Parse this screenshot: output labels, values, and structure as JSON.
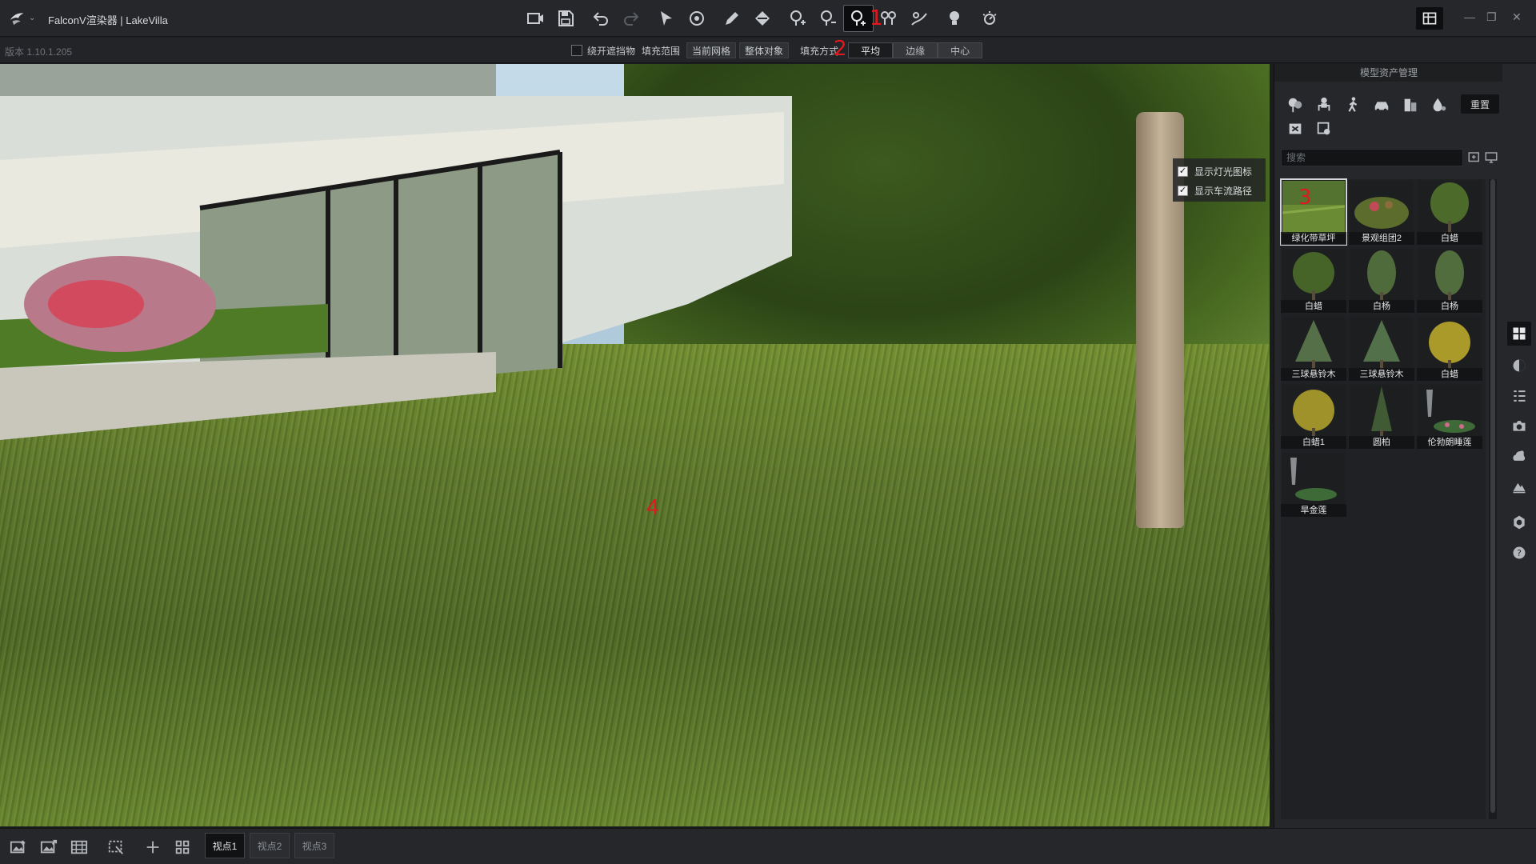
{
  "window": {
    "title": "FalconV渲染器 | LakeVilla",
    "version": "版本 1.10.1.205"
  },
  "toolbar": {
    "buttons": [
      {
        "icon": "camera-capture-icon"
      },
      {
        "icon": "save-icon"
      },
      {
        "icon": "undo-icon"
      },
      {
        "icon": "redo-icon"
      },
      {
        "icon": "select-arrow-icon"
      },
      {
        "icon": "rotate-view-icon"
      },
      {
        "icon": "pen-icon"
      },
      {
        "icon": "fill-bucket-icon"
      },
      {
        "icon": "plant-tree-icon"
      },
      {
        "icon": "plant-remove-icon"
      },
      {
        "icon": "plant-fill-icon"
      },
      {
        "icon": "plant-brush-icon"
      },
      {
        "icon": "plant-path-icon"
      },
      {
        "icon": "light-bulb-icon"
      },
      {
        "icon": "time-of-day-icon"
      }
    ],
    "active_index": 10,
    "marker_1": "1"
  },
  "fillbar": {
    "avoid_label": "绕开遮挡物",
    "range_label": "填充范围",
    "current_grid": "当前网格",
    "whole_object": "整体对象",
    "fill_mode_label": "填充方式",
    "marker_2": "2",
    "modes": [
      "平均",
      "边缘",
      "中心"
    ],
    "selected_mode": "平均"
  },
  "viewport": {
    "marker_4": "4",
    "overlay": {
      "show_light_icons": "显示灯光图标",
      "show_traffic_path": "显示车流路径"
    }
  },
  "panel": {
    "title": "模型资产管理",
    "reset_label": "重置",
    "search_placeholder": "搜索",
    "marker_3": "3",
    "categories": [
      "plants-category-icon",
      "people-sitting-icon",
      "people-walking-icon",
      "vehicle-icon",
      "building-icon",
      "water-drop-icon",
      "light-box-icon",
      "furniture-icon"
    ],
    "assets": [
      {
        "label": "绿化带草坪",
        "color": "#5c7a2e",
        "selected": true
      },
      {
        "label": "景观组团2",
        "color": "#6a7a36"
      },
      {
        "label": "白蜡",
        "color": "#4e6a2a"
      },
      {
        "label": "白蜡",
        "color": "#4a6428"
      },
      {
        "label": "白杨",
        "color": "#4d6a3a"
      },
      {
        "label": "白杨",
        "color": "#506c3c"
      },
      {
        "label": "三球悬铃木",
        "color": "#557048"
      },
      {
        "label": "三球悬铃木",
        "color": "#52704a"
      },
      {
        "label": "白蜡",
        "color": "#a99a2a"
      },
      {
        "label": "白蜡1",
        "color": "#9f922a"
      },
      {
        "label": "圆柏",
        "color": "#3f5a34"
      },
      {
        "label": "伦勃朗睡莲",
        "color": "#6c6f70"
      },
      {
        "label": "旱金莲",
        "color": "#707273"
      }
    ]
  },
  "sidestrip": {
    "icons": [
      "asset-grid-icon",
      "environment-icon",
      "layers-list-icon",
      "camera-icon",
      "weather-cloud-icon",
      "terrain-icon",
      "settings-gear-icon",
      "help-icon"
    ]
  },
  "bottombar": {
    "tools": [
      "add-image-icon",
      "export-image-icon",
      "batch-export-icon",
      "region-render-icon",
      "add-icon",
      "grid-view-icon"
    ],
    "tabs": [
      "视点1",
      "视点2",
      "视点3"
    ],
    "active_tab": "视点1"
  }
}
